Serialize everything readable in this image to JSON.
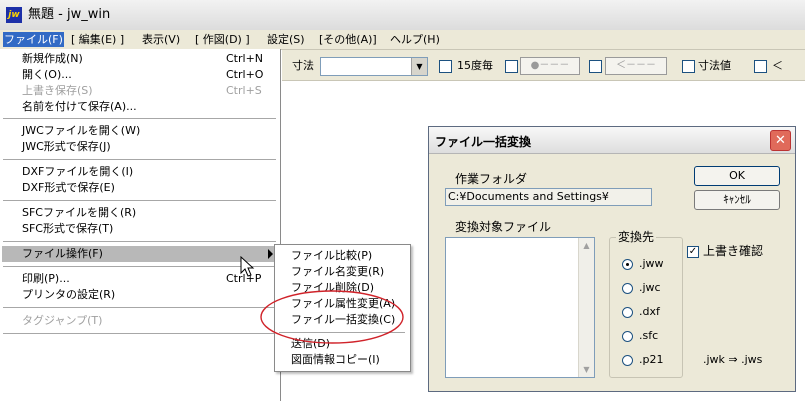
{
  "window": {
    "title": "無題 - jw_win",
    "icon": "jw-app-icon"
  },
  "menubar": [
    "ファイル(F)",
    "[ 編集(E) ]",
    "表示(V)",
    "[ 作図(D) ]",
    "設定(S)",
    "[その他(A)]",
    "ヘルプ(H)"
  ],
  "toolbar": {
    "dim_label": "寸法",
    "dim_value": "",
    "angle15": "15度毎",
    "btn_a": "●－－－",
    "btn_b": "＜－－－",
    "dim_value_label": "寸法値",
    "last_label": "＜"
  },
  "file_menu": {
    "new": "新規作成(N)",
    "new_sc": "Ctrl+N",
    "open": "開く(O)...",
    "open_sc": "Ctrl+O",
    "overwrite": "上書き保存(S)",
    "overwrite_sc": "Ctrl+S",
    "save_as": "名前を付けて保存(A)...",
    "jwc_open": "JWCファイルを開く(W)",
    "jwc_save": "JWC形式で保存(J)",
    "dxf_open": "DXFファイルを開く(I)",
    "dxf_save": "DXF形式で保存(E)",
    "sfc_open": "SFCファイルを開く(R)",
    "sfc_save": "SFC形式で保存(T)",
    "file_ops": "ファイル操作(F)",
    "print": "印刷(P)...",
    "print_sc": "Ctrl+P",
    "printer_setup": "プリンタの設定(R)",
    "tag_jump": "タグジャンプ(T)"
  },
  "submenu": {
    "compare": "ファイル比較(P)",
    "rename": "ファイル名変更(R)",
    "delete": "ファイル削除(D)",
    "attr": "ファイル属性変更(A)",
    "batch": "ファイル一括変換(C)",
    "send": "送信(D)",
    "info_copy": "図面情報コピー(I)"
  },
  "dialog": {
    "title": "ファイル一括変換",
    "work_folder_label": "作業フォルダ",
    "work_folder_value": "C:¥Documents and Settings¥",
    "target_files_label": "変換対象ファイル",
    "dest_label": "変換先",
    "options": [
      ".jww",
      ".jwc",
      ".dxf",
      ".sfc",
      ".p21"
    ],
    "selected_option": ".jww",
    "ok": "OK",
    "cancel": "ｷｬﾝｾﾙ",
    "overwrite_confirm": "上書き確認",
    "overwrite_checked": true,
    "note": ".jwk ⇒ .jws"
  },
  "colors": {
    "highlight": "#316ac5",
    "menu_hover": "#b8b8b8",
    "annotation": "#d0232a",
    "dialog_bg": "#ece9d8"
  }
}
